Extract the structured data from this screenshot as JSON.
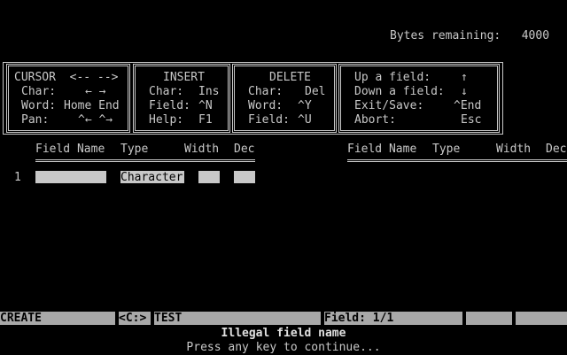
{
  "bytes_remaining": {
    "label": "Bytes remaining:",
    "value": "4000"
  },
  "menu": {
    "cursor": {
      "title": "CURSOR  <-- -->",
      "rows": [
        {
          "label": "Char:",
          "value": "← →"
        },
        {
          "label": "Word:",
          "value": "Home End"
        },
        {
          "label": "Pan:",
          "value": "^← ^→"
        }
      ]
    },
    "insert": {
      "title": "INSERT",
      "rows": [
        {
          "label": "Char:",
          "value": "Ins"
        },
        {
          "label": "Field:",
          "value": "^N"
        },
        {
          "label": "Help:",
          "value": "F1"
        }
      ]
    },
    "delete": {
      "title": "DELETE",
      "rows": [
        {
          "label": "Char:",
          "value": "Del"
        },
        {
          "label": "Word:",
          "value": "^Y"
        },
        {
          "label": "Field:",
          "value": "^U"
        }
      ]
    },
    "other": {
      "rows": [
        {
          "label": "Up a field:",
          "value": "↑"
        },
        {
          "label": "Down a field:",
          "value": "↓"
        },
        {
          "label": "Exit/Save:",
          "value": "^End"
        },
        {
          "label": "Abort:",
          "value": "Esc"
        }
      ]
    }
  },
  "table": {
    "headers": [
      "Field Name",
      "Type",
      "Width",
      "Dec"
    ],
    "rows": [
      {
        "num": "1",
        "name": "",
        "type": "Character",
        "width": "",
        "dec": ""
      }
    ]
  },
  "status_bar": {
    "mode": "CREATE",
    "drive": "<C:>",
    "file": "TEST",
    "field": "Field: 1/1"
  },
  "messages": {
    "error": "Illegal field name",
    "prompt": "Press any key to continue..."
  }
}
